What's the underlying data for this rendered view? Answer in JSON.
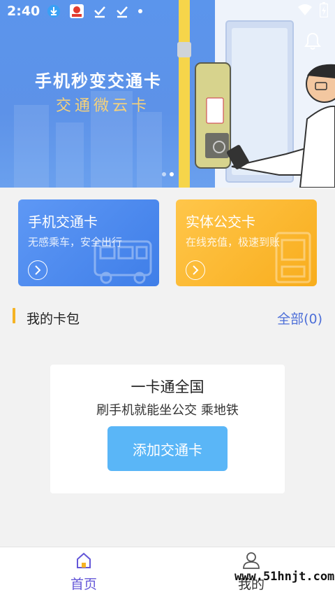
{
  "status_bar": {
    "time": "2:40"
  },
  "banner": {
    "title": "手机秒变交通卡",
    "subtitle": "交通微云卡",
    "pager": {
      "count": 2,
      "active": 1
    }
  },
  "cards": [
    {
      "title": "手机交通卡",
      "subtitle": "无感乘车，安全出行",
      "color": "#4a88ee"
    },
    {
      "title": "实体公交卡",
      "subtitle": "在线充值，极速到账",
      "color": "#fbb52b"
    }
  ],
  "wallet": {
    "title": "我的卡包",
    "all_link": "全部(0)",
    "empty_title": "一卡通全国",
    "empty_subtitle": "刷手机就能坐公交 乘地铁",
    "add_button": "添加交通卡"
  },
  "tabbar": {
    "tabs": [
      {
        "label": "首页",
        "icon": "home-icon",
        "active": true
      },
      {
        "label": "我的",
        "icon": "user-icon",
        "active": false
      }
    ]
  },
  "watermark": "www.51hnjt.com",
  "colors": {
    "accent": "#6457d8",
    "link": "#4d6fd8",
    "button": "#5ab6f7",
    "section_bar": "#f5b324"
  }
}
